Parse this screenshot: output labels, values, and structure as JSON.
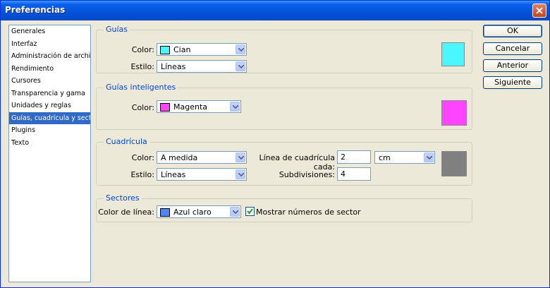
{
  "window": {
    "title": "Preferencias"
  },
  "sidebar": {
    "items": [
      {
        "label": "Generales"
      },
      {
        "label": "Interfaz"
      },
      {
        "label": "Administración de archivos"
      },
      {
        "label": "Rendimiento"
      },
      {
        "label": "Cursores"
      },
      {
        "label": "Transparencia y gama"
      },
      {
        "label": "Unidades y reglas"
      },
      {
        "label": "Guías, cuadrícula y sectores",
        "selected": true
      },
      {
        "label": "Plugins"
      },
      {
        "label": "Texto"
      }
    ]
  },
  "guias": {
    "legend": "Guías",
    "color_label": "Color:",
    "color_value": "Cian",
    "color_hex": "#4af7fc",
    "style_label": "Estilo:",
    "style_value": "Líneas"
  },
  "inteligentes": {
    "legend": "Guías inteligentes",
    "color_label": "Color:",
    "color_value": "Magenta",
    "color_hex": "#ff44ff"
  },
  "cuadricula": {
    "legend": "Cuadrícula",
    "color_label": "Color:",
    "color_value": "A medida",
    "color_hex": "#808080",
    "style_label": "Estilo:",
    "style_value": "Líneas",
    "every_label": "Línea de cuadrícula cada:",
    "every_value": "2",
    "unit_value": "cm",
    "subdiv_label": "Subdivisiones:",
    "subdiv_value": "4"
  },
  "sectores": {
    "legend": "Sectores",
    "line_color_label": "Color de línea:",
    "line_color_value": "Azul claro",
    "line_color_hex": "#4f86f7",
    "show_numbers_label": "Mostrar números de sector",
    "show_numbers_checked": true
  },
  "buttons": {
    "ok": "OK",
    "cancel": "Cancelar",
    "prev": "Anterior",
    "next": "Siguiente"
  }
}
